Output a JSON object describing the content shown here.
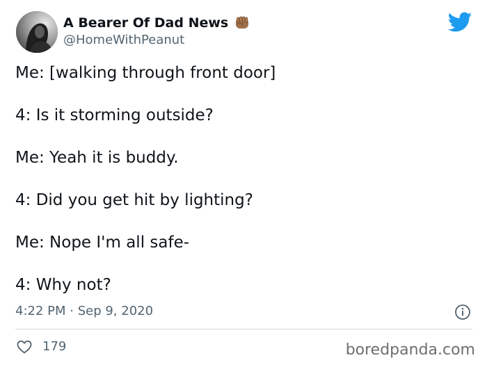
{
  "author": {
    "display_name": "A Bearer Of Dad News",
    "handle": "@HomeWithPeanut"
  },
  "tweet": {
    "lines": [
      "Me: [walking through front door]",
      "4: Is it storming outside?",
      "Me: Yeah it is buddy.",
      "4: Did you get hit by lighting?",
      "Me: Nope I'm all safe-",
      "4: Why not?"
    ],
    "timestamp": "4:22 PM · Sep 9, 2020"
  },
  "engagement": {
    "likes": "179"
  },
  "watermark": "boredpanda.com",
  "colors": {
    "twitter_blue": "#1d9bf0",
    "secondary_text": "#536471",
    "primary_text": "#0f1419",
    "divider": "#cfd9de",
    "fist_emoji": "#a0704a"
  },
  "icons": {
    "brand": "twitter-bird-icon",
    "name_emoji": "raised-fist-emoji-icon",
    "info": "info-icon",
    "like": "heart-icon"
  }
}
